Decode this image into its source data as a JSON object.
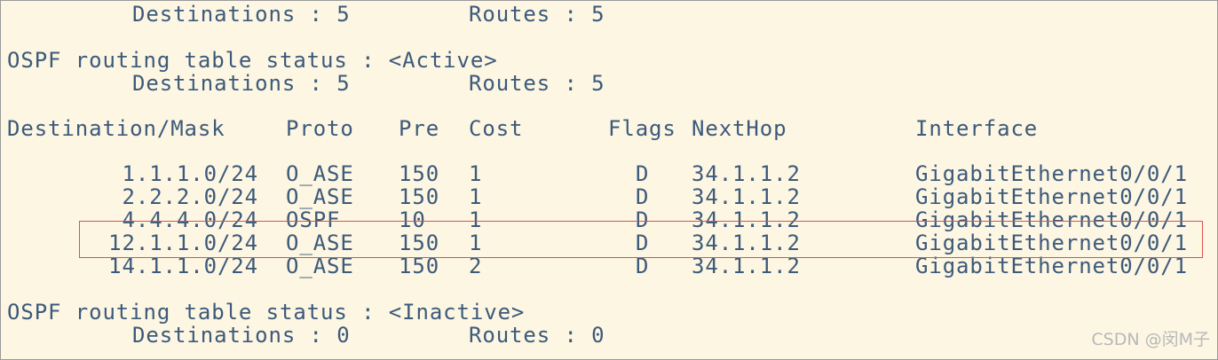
{
  "header": {
    "top_destinations": "Destinations : 5",
    "top_routes": "Routes : 5",
    "active_status": "OSPF routing table status : <Active>",
    "active_destinations": "Destinations : 5",
    "active_routes": "Routes : 5"
  },
  "table": {
    "columns": {
      "destination": "Destination/Mask",
      "proto": "Proto",
      "pre": "Pre",
      "cost": "Cost",
      "flags": "Flags",
      "nexthop": "NextHop",
      "interface": "Interface"
    },
    "rows": [
      {
        "destination": "1.1.1.0/24",
        "proto": "O_ASE",
        "pre": "150",
        "cost": "1",
        "flags": "D",
        "nexthop": "34.1.1.2",
        "interface": "GigabitEthernet0/0/1"
      },
      {
        "destination": "2.2.2.0/24",
        "proto": "O_ASE",
        "pre": "150",
        "cost": "1",
        "flags": "D",
        "nexthop": "34.1.1.2",
        "interface": "GigabitEthernet0/0/1"
      },
      {
        "destination": "4.4.4.0/24",
        "proto": "OSPF",
        "pre": "10",
        "cost": "1",
        "flags": "D",
        "nexthop": "34.1.1.2",
        "interface": "GigabitEthernet0/0/1"
      },
      {
        "destination": "12.1.1.0/24",
        "proto": "O_ASE",
        "pre": "150",
        "cost": "1",
        "flags": "D",
        "nexthop": "34.1.1.2",
        "interface": "GigabitEthernet0/0/1"
      },
      {
        "destination": "14.1.1.0/24",
        "proto": "O_ASE",
        "pre": "150",
        "cost": "2",
        "flags": "D",
        "nexthop": "34.1.1.2",
        "interface": "GigabitEthernet0/0/1"
      }
    ]
  },
  "footer": {
    "inactive_status": "OSPF routing table status : <Inactive>",
    "inactive_destinations": "Destinations : 0",
    "inactive_routes": "Routes : 0"
  },
  "watermark": "CSDN @闵M子",
  "colors": {
    "background": "#fdf6e3",
    "text": "#3c5a7a",
    "highlight": "#d9534f"
  }
}
